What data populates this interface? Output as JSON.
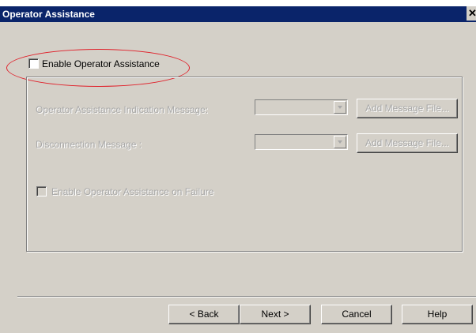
{
  "window": {
    "title": "Operator Assistance",
    "close_glyph": "✕"
  },
  "enable_option": {
    "label": "Enable Operator Assistance",
    "checked": false
  },
  "group": {
    "indication_label": "Operator Assistance Indication Message:",
    "indication_value": "",
    "indication_button": "Add Message File...",
    "disconnection_label": "Disconnection Message :",
    "disconnection_value": "",
    "disconnection_button": "Add Message File...",
    "failure_label": "Enable Operator Assistance on Failure",
    "failure_checked": false
  },
  "footer": {
    "back_label": "< Back",
    "next_label": "Next >",
    "cancel_label": "Cancel",
    "help_label": "Help"
  },
  "colors": {
    "titlebar": "#0a246a",
    "dialog": "#d4d0c8",
    "annotation": "#e0202a",
    "disabled_text": "#a8a8a8"
  }
}
